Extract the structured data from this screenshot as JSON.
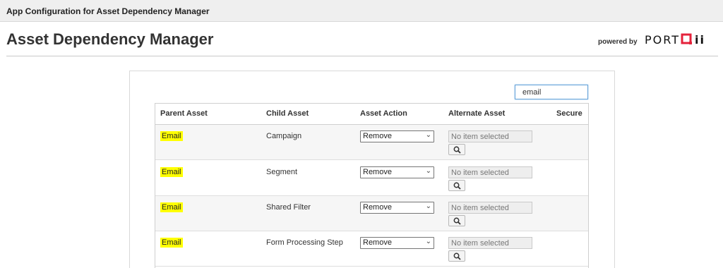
{
  "topbar": {
    "title": "App Configuration for Asset Dependency Manager"
  },
  "header": {
    "title": "Asset Dependency Manager",
    "powered_by": "powered by",
    "logo_text_left": "PORT",
    "logo_text_right": "ii"
  },
  "search": {
    "value": "email"
  },
  "table": {
    "columns": [
      "Parent Asset",
      "Child Asset",
      "Asset Action",
      "Alternate Asset",
      "Secure"
    ],
    "rows": [
      {
        "parent": "Email",
        "child": "Campaign",
        "action": "Remove",
        "alternate": "No item selected"
      },
      {
        "parent": "Email",
        "child": "Segment",
        "action": "Remove",
        "alternate": "No item selected"
      },
      {
        "parent": "Email",
        "child": "Shared Filter",
        "action": "Remove",
        "alternate": "No item selected"
      },
      {
        "parent": "Email",
        "child": "Form Processing Step",
        "action": "Remove",
        "alternate": "No item selected"
      }
    ]
  },
  "colors": {
    "highlight": "#ffff00",
    "logo_accent": "#e4223b",
    "focus_border": "#66a3d9"
  },
  "icons": {
    "lookup": "search-icon",
    "dropdown": "chevron-down-icon"
  }
}
